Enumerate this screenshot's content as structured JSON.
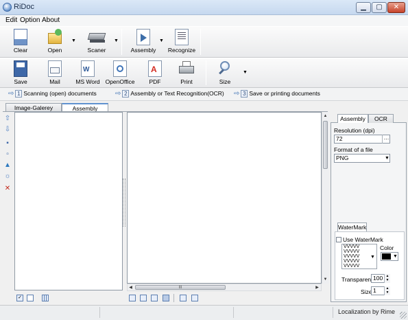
{
  "window": {
    "title": "RiDoc",
    "minimize": "▁",
    "maximize": "▢",
    "close": "✕"
  },
  "menu": [
    "Edit",
    "Option",
    "About"
  ],
  "toolbar1": {
    "clear": "Clear",
    "open": "Open",
    "scaner": "Scaner",
    "assembly": "Assembly",
    "recognize": "Recognize"
  },
  "toolbar2": {
    "save": "Save",
    "mail": "Mail",
    "msword": "MS Word",
    "openoffice": "OpenOffice",
    "pdf": "PDF",
    "print": "Print",
    "size": "Size"
  },
  "steps": [
    {
      "num": "1",
      "label": "Scanning (open) documents"
    },
    {
      "num": "2",
      "label": "Assembly or Text Recognition(OCR)"
    },
    {
      "num": "3",
      "label": "Save or printing documents"
    }
  ],
  "tabs": {
    "gallery": "Image-Galerey",
    "assembly": "Assembly"
  },
  "right_panel": {
    "tab_assembly": "Assembly",
    "tab_ocr": "OCR",
    "resolution_label": "Resolution (dpi)",
    "resolution_value": "72",
    "format_label": "Format of a file",
    "format_value": "PNG",
    "watermark_tab": "WaterMark",
    "use_watermark": "Use WaterMark",
    "watermark_text": "VVVVV\nVVVVV\nVVVVV\nVVVVV\nVVVVV",
    "color_label": "Color",
    "transparent_label": "Transparent",
    "transparent_value": "100",
    "size_label": "Size",
    "size_value": "1"
  },
  "hscroll_grip": "III",
  "status": {
    "localization": "Localization by Rime"
  },
  "colors": {
    "accent": "#5f92d0",
    "title_bg": "#c5d8ef",
    "pdf_red": "#d32a1f"
  }
}
